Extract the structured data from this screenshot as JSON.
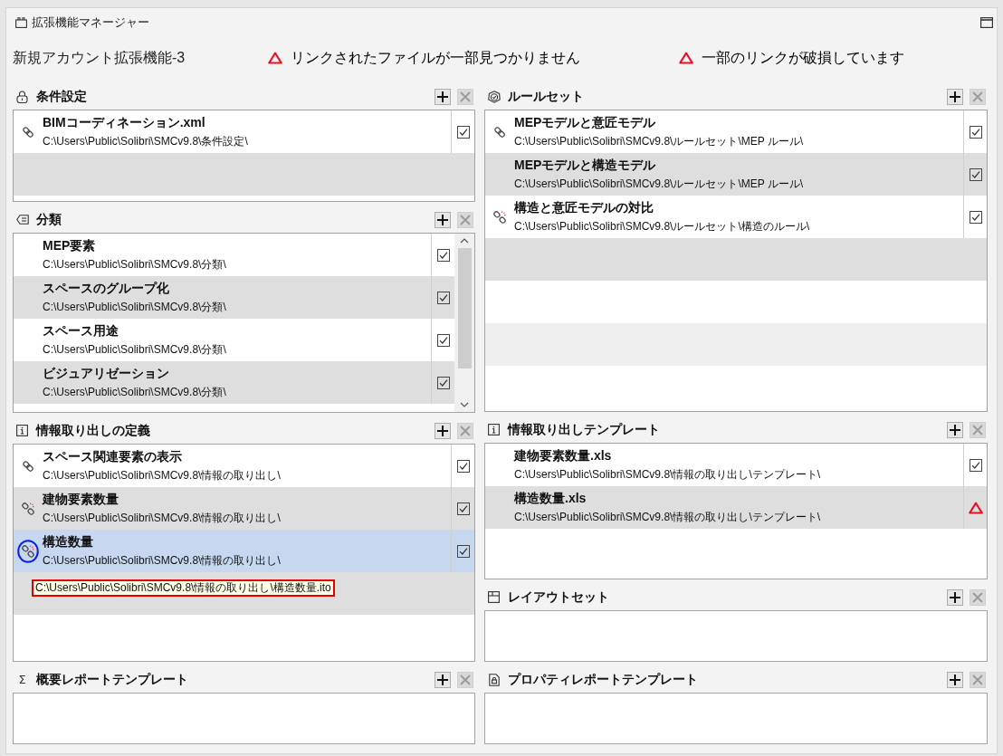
{
  "window": {
    "title": "拡張機能マネージャー"
  },
  "header": {
    "name": "新規アカウント拡張機能-3",
    "warnings": [
      "リンクされたファイルが一部見つかりません",
      "一部のリンクが破損しています"
    ]
  },
  "columns": [
    {
      "panels": [
        {
          "title": "条件設定",
          "remove_enabled": false,
          "scrollable": false,
          "rows": [
            {
              "kind": "linked",
              "name": "BIMコーディネーション.xml",
              "path": "C:\\Users\\Public\\Solibri\\SMCv9.8\\条件設定\\",
              "checked": true,
              "selected": false
            }
          ]
        },
        {
          "title": "分類",
          "remove_enabled": false,
          "scrollable": true,
          "rows": [
            {
              "kind": "plain",
              "name": "MEP要素",
              "path": "C:\\Users\\Public\\Solibri\\SMCv9.8\\分類\\",
              "checked": true,
              "selected": false
            },
            {
              "kind": "plain",
              "name": "スペースのグループ化",
              "path": "C:\\Users\\Public\\Solibri\\SMCv9.8\\分類\\",
              "checked": true,
              "selected": false
            },
            {
              "kind": "plain",
              "name": "スペース用途",
              "path": "C:\\Users\\Public\\Solibri\\SMCv9.8\\分類\\",
              "checked": true,
              "selected": false
            },
            {
              "kind": "plain",
              "name": "ビジュアリゼーション",
              "path": "C:\\Users\\Public\\Solibri\\SMCv9.8\\分類\\",
              "checked": true,
              "selected": false
            }
          ]
        },
        {
          "title": "情報取り出しの定義",
          "remove_enabled": false,
          "scrollable": false,
          "rows": [
            {
              "kind": "linked",
              "name": "スペース関連要素の表示",
              "path": "C:\\Users\\Public\\Solibri\\SMCv9.8\\情報の取り出し\\",
              "checked": true,
              "selected": false
            },
            {
              "kind": "broken",
              "name": "建物要素数量",
              "path": "C:\\Users\\Public\\Solibri\\SMCv9.8\\情報の取り出し\\",
              "checked": true,
              "selected": false
            },
            {
              "kind": "broken",
              "name": "構造数量",
              "path": "C:\\Users\\Public\\Solibri\\SMCv9.8\\情報の取り出し\\",
              "checked": true,
              "selected": true
            }
          ],
          "tooltip": "C:\\Users\\Public\\Solibri\\SMCv9.8\\情報の取り出し\\構造数量.ito"
        },
        {
          "symbol": "Σ",
          "title": "概要レポートテンプレート",
          "remove_enabled": false,
          "scrollable": false
        }
      ]
    },
    {
      "panels": [
        {
          "title": "ルールセット",
          "remove_enabled": false,
          "scrollable": false,
          "rows": [
            {
              "kind": "linked",
              "name": "MEPモデルと意匠モデル",
              "path": "C:\\Users\\Public\\Solibri\\SMCv9.8\\ルールセット\\MEP ルール\\",
              "checked": true,
              "selected": false
            },
            {
              "kind": "plain",
              "name": "MEPモデルと構造モデル",
              "path": "C:\\Users\\Public\\Solibri\\SMCv9.8\\ルールセット\\MEP ルール\\",
              "checked": true,
              "selected": false
            },
            {
              "kind": "broken",
              "name": "構造と意匠モデルの対比",
              "path": "C:\\Users\\Public\\Solibri\\SMCv9.8\\ルールセット\\構造のルール\\",
              "checked": true,
              "selected": false
            }
          ]
        },
        {
          "title": "情報取り出しテンプレート",
          "remove_enabled": false,
          "scrollable": false,
          "rows": [
            {
              "kind": "plain",
              "name": "建物要素数量.xls",
              "path": "C:\\Users\\Public\\Solibri\\SMCv9.8\\情報の取り出し\\テンプレート\\",
              "missing": false,
              "checked": true,
              "selected": false
            },
            {
              "kind": "plain",
              "name": "構造数量.xls",
              "path": "C:\\Users\\Public\\Solibri\\SMCv9.8\\情報の取り出し\\テンプレート\\",
              "missing": true,
              "selected": false
            }
          ]
        },
        {
          "title": "レイアウトセット",
          "remove_enabled": false,
          "scrollable": false
        },
        {
          "title": "プロパティレポートテンプレート",
          "remove_enabled": false,
          "scrollable": false
        }
      ]
    }
  ]
}
